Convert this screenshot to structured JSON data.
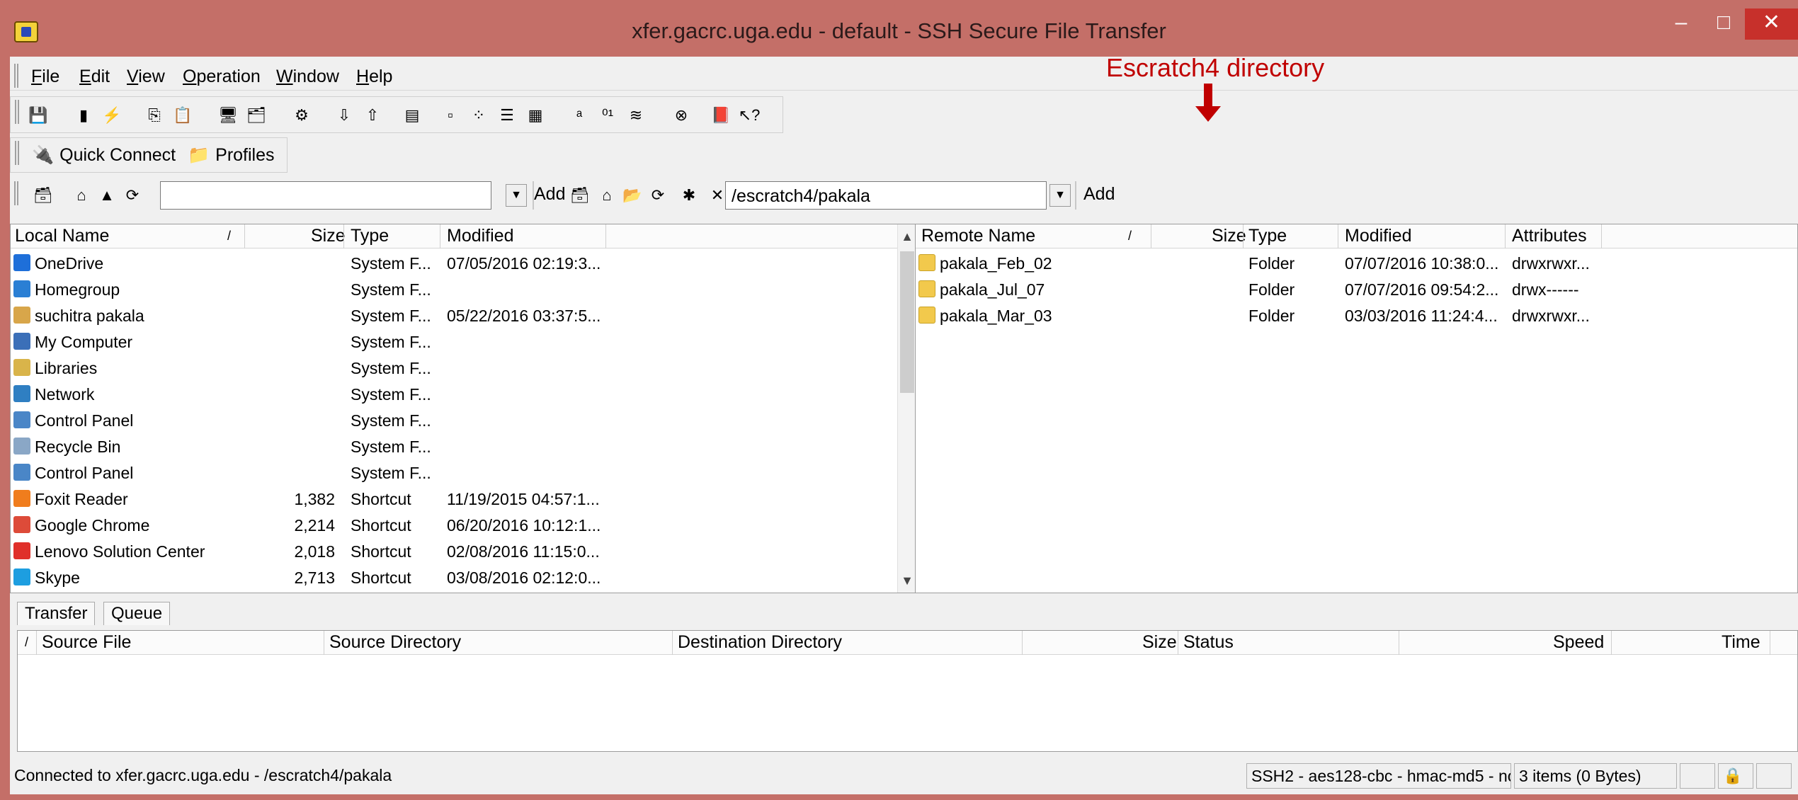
{
  "window": {
    "title": "xfer.gacrc.uga.edu - default - SSH Secure File Transfer",
    "min": "–",
    "max": "□",
    "close": "✕"
  },
  "menu": [
    "File",
    "Edit",
    "View",
    "Operation",
    "Window",
    "Help"
  ],
  "quick": {
    "connect": "Quick Connect",
    "profiles": "Profiles"
  },
  "annotation": "Escratch4 directory",
  "local": {
    "path": "",
    "add": "Add",
    "headers": {
      "name": "Local Name",
      "sort": "/",
      "size": "Size",
      "type": "Type",
      "modified": "Modified"
    },
    "rows": [
      {
        "name": "OneDrive",
        "size": "",
        "type": "System F...",
        "modified": "07/05/2016 02:19:3...",
        "icon": "cloud-icon",
        "color": "#1e6fd9"
      },
      {
        "name": "Homegroup",
        "size": "",
        "type": "System F...",
        "modified": "",
        "icon": "homegroup-icon",
        "color": "#2a7fd4"
      },
      {
        "name": "suchitra pakala",
        "size": "",
        "type": "System F...",
        "modified": "05/22/2016 03:37:5...",
        "icon": "user-folder-icon",
        "color": "#d8a64a"
      },
      {
        "name": "My Computer",
        "size": "",
        "type": "System F...",
        "modified": "",
        "icon": "computer-icon",
        "color": "#3b6fb8"
      },
      {
        "name": "Libraries",
        "size": "",
        "type": "System F...",
        "modified": "",
        "icon": "libraries-icon",
        "color": "#d9b44a"
      },
      {
        "name": "Network",
        "size": "",
        "type": "System F...",
        "modified": "",
        "icon": "network-icon",
        "color": "#2f7fc2"
      },
      {
        "name": "Control Panel",
        "size": "",
        "type": "System F...",
        "modified": "",
        "icon": "control-panel-icon",
        "color": "#4a86c7"
      },
      {
        "name": "Recycle Bin",
        "size": "",
        "type": "System F...",
        "modified": "",
        "icon": "recycle-bin-icon",
        "color": "#8aa7c6"
      },
      {
        "name": "Control Panel",
        "size": "",
        "type": "System F...",
        "modified": "",
        "icon": "control-panel-icon",
        "color": "#4a86c7"
      },
      {
        "name": "Foxit Reader",
        "size": "1,382",
        "type": "Shortcut",
        "modified": "11/19/2015 04:57:1...",
        "icon": "foxit-icon",
        "color": "#f07d1d"
      },
      {
        "name": "Google Chrome",
        "size": "2,214",
        "type": "Shortcut",
        "modified": "06/20/2016 10:12:1...",
        "icon": "chrome-icon",
        "color": "#dd4b39"
      },
      {
        "name": "Lenovo Solution Center",
        "size": "2,018",
        "type": "Shortcut",
        "modified": "02/08/2016 11:15:0...",
        "icon": "lenovo-icon",
        "color": "#e0302a"
      },
      {
        "name": "Skype",
        "size": "2,713",
        "type": "Shortcut",
        "modified": "03/08/2016 02:12:0...",
        "icon": "skype-icon",
        "color": "#1d9ee0"
      }
    ]
  },
  "remote": {
    "path": "/escratch4/pakala",
    "add": "Add",
    "headers": {
      "name": "Remote Name",
      "sort": "/",
      "size": "Size",
      "type": "Type",
      "modified": "Modified",
      "attributes": "Attributes"
    },
    "rows": [
      {
        "name": "pakala_Feb_02",
        "type": "Folder",
        "modified": "07/07/2016 10:38:0...",
        "attributes": "drwxrwxr..."
      },
      {
        "name": "pakala_Jul_07",
        "type": "Folder",
        "modified": "07/07/2016 09:54:2...",
        "attributes": "drwx------"
      },
      {
        "name": "pakala_Mar_03",
        "type": "Folder",
        "modified": "03/03/2016 11:24:4...",
        "attributes": "drwxrwxr..."
      }
    ]
  },
  "tabs": {
    "transfer": "Transfer",
    "queue": "Queue"
  },
  "queue_headers": {
    "sort": "/",
    "source_file": "Source File",
    "source_dir": "Source Directory",
    "dest_dir": "Destination Directory",
    "size": "Size",
    "status": "Status",
    "speed": "Speed",
    "time": "Time"
  },
  "status": {
    "connection": "Connected to xfer.gacrc.uga.edu - /escratch4/pakala",
    "cipher": "SSH2 - aes128-cbc - hmac-md5 - no",
    "items": "3 items (0 Bytes)"
  }
}
